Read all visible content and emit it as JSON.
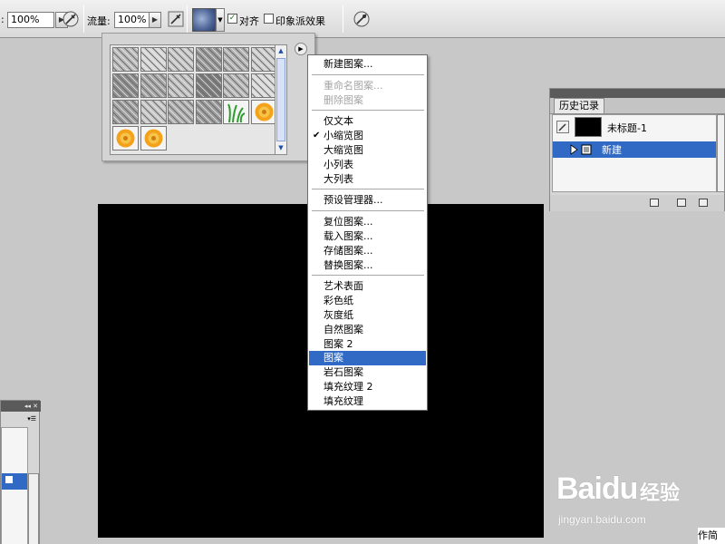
{
  "options_bar": {
    "opacity_label_fragment": ":",
    "opacity_value": "100%",
    "flow_label": "流量:",
    "flow_value": "100%",
    "aligned_label": "对齐",
    "aligned_checked": true,
    "impressionist_label": "印象派效果",
    "impressionist_checked": false,
    "icons": [
      "airbrush-icon",
      "pattern-swatch",
      "tablet-pressure-icon"
    ]
  },
  "pattern_picker": {
    "flyout_icon": "triangle-right-icon",
    "pattern_count": 20,
    "tile_colors": [
      "#bdbdbd",
      "#d8d8d8",
      "#c9c9c9",
      "#9a9a9a",
      "#b3b3b3",
      "#cfcfcf",
      "#8f8f8f",
      "#a7a7a7",
      "#c2c2c2",
      "#7e7e7e",
      "#b9b9b9",
      "#dadada",
      "#a2a2a2",
      "#c8c8c8",
      "#b0b0b0",
      "#9c9c9c",
      "grass",
      "flower",
      "flower",
      "flower"
    ]
  },
  "context_menu": {
    "groups": [
      [
        {
          "label": "新建图案...",
          "state": "normal"
        }
      ],
      [
        {
          "label": "重命名图案...",
          "state": "disabled"
        },
        {
          "label": "删除图案",
          "state": "disabled"
        }
      ],
      [
        {
          "label": "仅文本",
          "state": "normal"
        },
        {
          "label": "小缩览图",
          "state": "checked"
        },
        {
          "label": "大缩览图",
          "state": "normal"
        },
        {
          "label": "小列表",
          "state": "normal"
        },
        {
          "label": "大列表",
          "state": "normal"
        }
      ],
      [
        {
          "label": "预设管理器...",
          "state": "normal"
        }
      ],
      [
        {
          "label": "复位图案...",
          "state": "normal"
        },
        {
          "label": "载入图案...",
          "state": "normal"
        },
        {
          "label": "存储图案...",
          "state": "normal"
        },
        {
          "label": "替换图案...",
          "state": "normal"
        }
      ],
      [
        {
          "label": "艺术表面",
          "state": "normal"
        },
        {
          "label": "彩色纸",
          "state": "normal"
        },
        {
          "label": "灰度纸",
          "state": "normal"
        },
        {
          "label": "自然图案",
          "state": "normal"
        },
        {
          "label": "图案 2",
          "state": "normal"
        },
        {
          "label": "图案",
          "state": "selected"
        },
        {
          "label": "岩石图案",
          "state": "normal"
        },
        {
          "label": "填充纹理 2",
          "state": "normal"
        },
        {
          "label": "填充纹理",
          "state": "normal"
        }
      ]
    ],
    "selected_color": "#316ac5"
  },
  "history_panel": {
    "tab_label": "历史记录",
    "snapshot_label": "未标题-1",
    "states": [
      {
        "label": "新建",
        "selected": true
      }
    ]
  },
  "canvas": {
    "fill": "#000000"
  },
  "watermark": {
    "brand": "Baidu",
    "brand_cn": "经验",
    "url": "jingyan.baidu.com"
  },
  "corner_note": "作简"
}
